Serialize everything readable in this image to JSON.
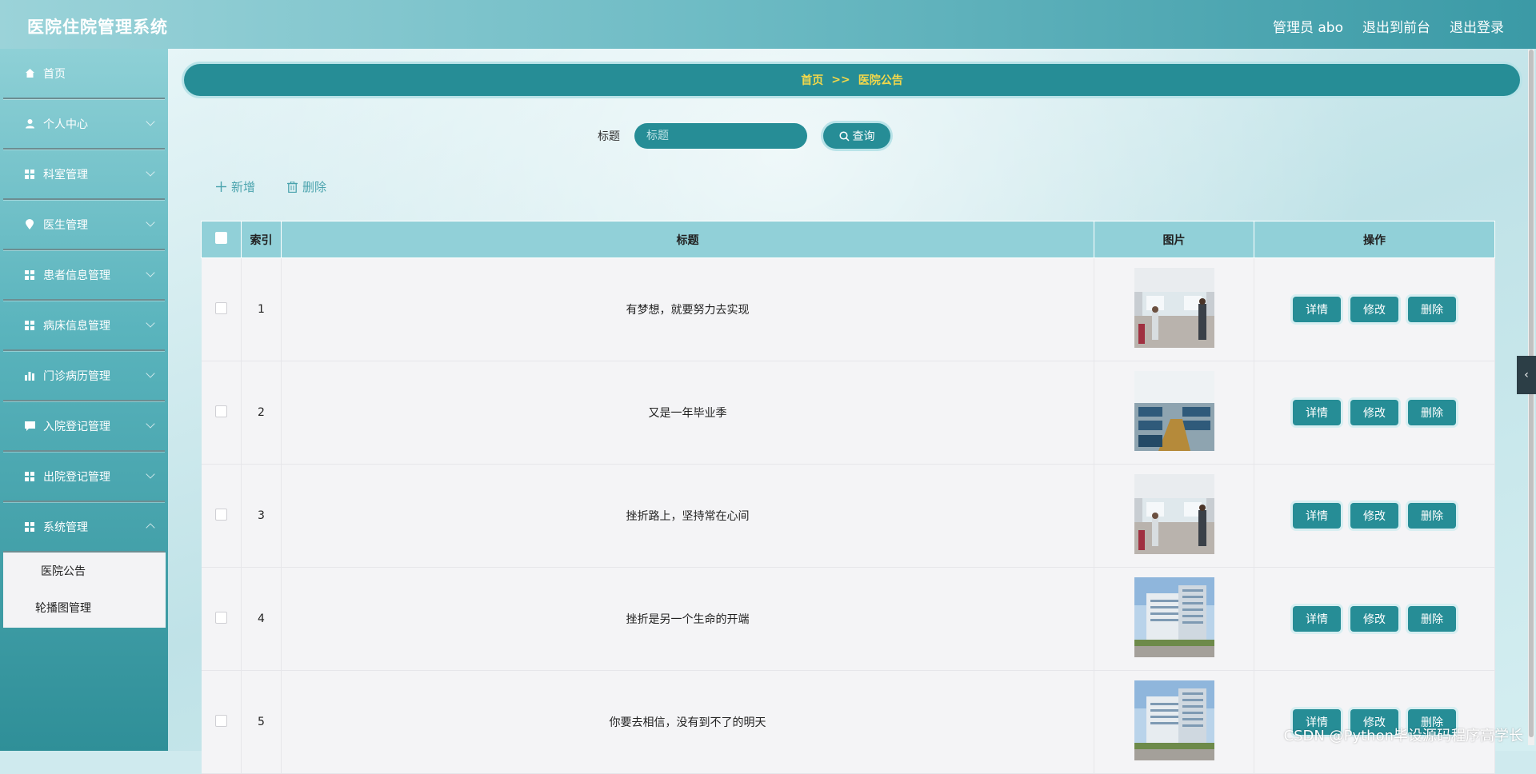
{
  "header": {
    "title": "医院住院管理系统",
    "user": "管理员 abo",
    "to_front": "退出到前台",
    "logout": "退出登录"
  },
  "sidebar": {
    "items": [
      {
        "label": "首页",
        "icon": "home-icon"
      },
      {
        "label": "个人中心",
        "icon": "user-icon"
      },
      {
        "label": "科室管理",
        "icon": "grid-icon"
      },
      {
        "label": "医生管理",
        "icon": "pin-icon"
      },
      {
        "label": "患者信息管理",
        "icon": "grid-icon"
      },
      {
        "label": "病床信息管理",
        "icon": "grid-icon"
      },
      {
        "label": "门诊病历管理",
        "icon": "bar-chart-icon"
      },
      {
        "label": "入院登记管理",
        "icon": "chat-icon"
      },
      {
        "label": "出院登记管理",
        "icon": "grid-icon"
      },
      {
        "label": "系统管理",
        "icon": "grid-icon"
      }
    ],
    "submenu": [
      "医院公告",
      "轮播图管理"
    ]
  },
  "breadcrumb": {
    "home": "首页",
    "sep": ">>",
    "current": "医院公告"
  },
  "search": {
    "label": "标题",
    "placeholder": "标题",
    "button": "查询"
  },
  "actions": {
    "add": "新增",
    "delete": "删除"
  },
  "table": {
    "headers": {
      "index": "索引",
      "title": "标题",
      "image": "图片",
      "ops": "操作"
    },
    "buttons": {
      "detail": "详情",
      "edit": "修改",
      "delete": "删除"
    },
    "rows": [
      {
        "index": "1",
        "title": "有梦想，就要努力去实现",
        "image": "clinic-counter"
      },
      {
        "index": "2",
        "title": "又是一年毕业季",
        "image": "waiting-room"
      },
      {
        "index": "3",
        "title": "挫折路上，坚持常在心间",
        "image": "clinic-counter"
      },
      {
        "index": "4",
        "title": "挫折是另一个生命的开端",
        "image": "hospital-building"
      },
      {
        "index": "5",
        "title": "你要去相信，没有到不了的明天",
        "image": "hospital-building"
      }
    ]
  },
  "watermark": "CSDN @Python毕设源码程序高学长",
  "colors": {
    "accent": "#268d96",
    "breadcrumb_text": "#f3d84a",
    "table_head": "#91d0d8"
  }
}
